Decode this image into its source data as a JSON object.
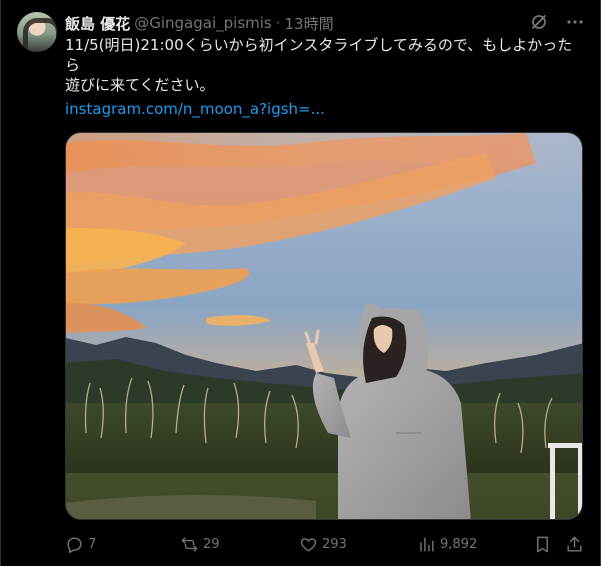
{
  "user": {
    "display_name": "飯島 優花",
    "handle": "@Gingagai_pismis",
    "separator": "·",
    "time": "13時間"
  },
  "tweet": {
    "text": "11/5(明日)21:00くらいから初インスタライブしてみるので、もしよかったら\n遊びに来てください。",
    "link": "instagram.com/n_moon_a?igsh=..."
  },
  "actions": {
    "replies": "7",
    "retweets": "29",
    "likes": "293",
    "views": "9,892"
  },
  "icons": {
    "grok": "grok-icon",
    "more": "more-icon",
    "reply": "reply-icon",
    "retweet": "retweet-icon",
    "like": "heart-icon",
    "views": "views-icon",
    "bookmark": "bookmark-icon",
    "share": "share-icon"
  },
  "colors": {
    "background": "#000000",
    "text": "#e7e9ea",
    "muted": "#71767b",
    "link": "#1d9bf0"
  }
}
